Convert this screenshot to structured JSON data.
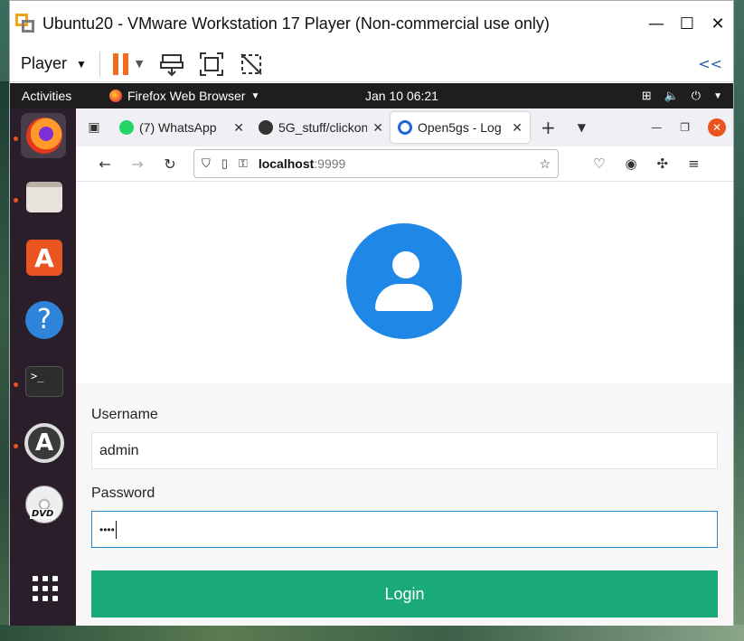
{
  "vmware": {
    "title": "Ubuntu20 - VMware Workstation 17 Player (Non-commercial use only)",
    "player_menu": "Player",
    "controls": {
      "minimize": "—",
      "maximize": "☐",
      "close": "✕"
    },
    "collapse_label": "<<"
  },
  "ubuntu": {
    "activities": "Activities",
    "app_name": "Firefox Web Browser",
    "clock": "Jan 10  06:21",
    "dock": [
      "firefox",
      "files",
      "ubuntu-software",
      "help",
      "terminal",
      "software-updater",
      "dvd",
      "show-applications"
    ]
  },
  "firefox": {
    "tabs": [
      {
        "label": "(7) WhatsApp",
        "icon": "whatsapp-icon"
      },
      {
        "label": "5G_stuff/clickon",
        "icon": "github-icon"
      },
      {
        "label": "Open5gs - Log",
        "icon": "open5gs-icon",
        "selected": true
      }
    ],
    "url": {
      "host": "localhost",
      "port": ":9999"
    }
  },
  "login": {
    "username_label": "Username",
    "username_value": "admin",
    "password_label": "Password",
    "password_value": "••••",
    "login_button": "Login"
  },
  "colors": {
    "accent_orange": "#f26c1f",
    "avatar_blue": "#1f87e5",
    "login_green": "#19a97b",
    "ubuntu_orange": "#e9541f"
  }
}
